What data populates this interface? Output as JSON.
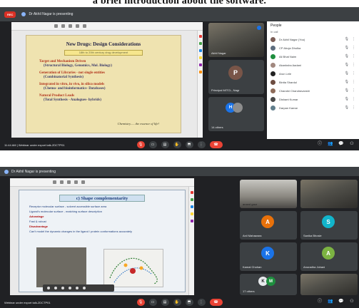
{
  "caption": "a brief introduction about the software.",
  "meeting_top": {
    "recording_label": "REC",
    "presenting": "Dr Akhil Nagar is presenting",
    "slide": {
      "title": "New Drugs: Design Considerations",
      "subtitle": "18th to 20th century drug development",
      "bullets": [
        {
          "main": "Target and Mechanism Driven",
          "sub": "(Structural Biology, Genomics, Mol. Biology)"
        },
        {
          "main": "Generation of Libraries - not single entities",
          "sub": "(Combinatorial Synthesis)"
        },
        {
          "main": "Integrated in vitro, in vivo, in silico models",
          "sub": "(Chemo- and bioinformatics- Databases)"
        },
        {
          "main": "Natural Product Leads",
          "sub": "(Total Synthesis - Analogues- hybrids)"
        }
      ],
      "footer": "Chemistry......the essence of life!"
    },
    "tiles": [
      {
        "name": "Akhil Nagar"
      },
      {
        "name": "Principal MITCL, Nagr",
        "initial": "P"
      },
      {
        "name": "14 others"
      }
    ],
    "people_panel": {
      "title": "People",
      "subtitle": "In call",
      "list": [
        "Dr Akhil Nagar (You)",
        "CP Ahuja Dholka",
        "Ali Bhat Naim",
        "Akanksha Aadani",
        "Arun Lele",
        "Binita Shardul",
        "Chandni Chandravanshi",
        "Dishant Kumar",
        "Darpan Kamar"
      ]
    },
    "controls": {
      "time": "11:44 AM",
      "separator": "|",
      "meeting_title": "Webinar under export talk-2DCTP01"
    }
  },
  "meeting_bottom": {
    "presenting": "Dr Akhil Nagar is presenting",
    "slide": {
      "title": "c) Shape complementarity",
      "bullets": [
        "Receptor molecular surface - solvent accessible surface area",
        "Ligand's molecular surface - matching surface description",
        "Advantage",
        "Fast & robust",
        "Disadvantage",
        "Can't model the dynamic changes in the ligand / protein conformations accurately"
      ]
    },
    "tiles": [
      {
        "name": "anand gaur"
      },
      {
        "name": ""
      },
      {
        "name": "Anil Mahawara",
        "initial": "A"
      },
      {
        "name": "Sanika Bhosle",
        "initial": "S"
      },
      {
        "name": "Kamal Chohan",
        "initial": "K"
      },
      {
        "name": "Anuradha Johani",
        "initial": "A"
      },
      {
        "name": "17 others",
        "initial": "M"
      }
    ],
    "controls": {
      "meeting_title": "Webinar under export talk-2DCTP01"
    }
  },
  "colors": {
    "meet_bg": "#202124",
    "end_call": "#ea4335",
    "slide_bg": "#efe3b0",
    "bullet_red": "#b03018"
  }
}
